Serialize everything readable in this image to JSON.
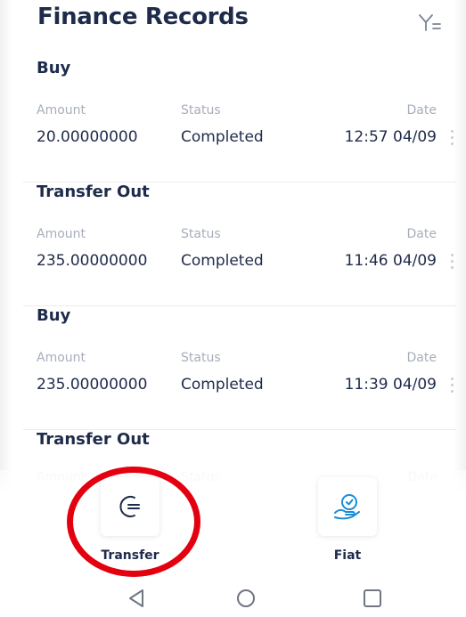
{
  "header": {
    "title": "Finance Records",
    "filter_icon": "filter-icon"
  },
  "columns": {
    "amount": "Amount",
    "status": "Status",
    "date": "Date"
  },
  "records": [
    {
      "type": "Buy",
      "amount": "20.00000000",
      "status": "Completed",
      "date": "12:57 04/09"
    },
    {
      "type": "Transfer Out",
      "amount": "235.00000000",
      "status": "Completed",
      "date": "11:46 04/09"
    },
    {
      "type": "Buy",
      "amount": "235.00000000",
      "status": "Completed",
      "date": "11:39 04/09"
    },
    {
      "type": "Transfer Out"
    }
  ],
  "actions": [
    {
      "label": "Transfer",
      "icon": "transfer-icon"
    },
    {
      "label": "Fiat",
      "icon": "fiat-icon"
    }
  ],
  "annotation": {
    "highlight_color": "#e3000f"
  },
  "nav": {
    "back_icon": "back-icon",
    "home_icon": "home-icon",
    "recent_icon": "recent-apps-icon"
  }
}
